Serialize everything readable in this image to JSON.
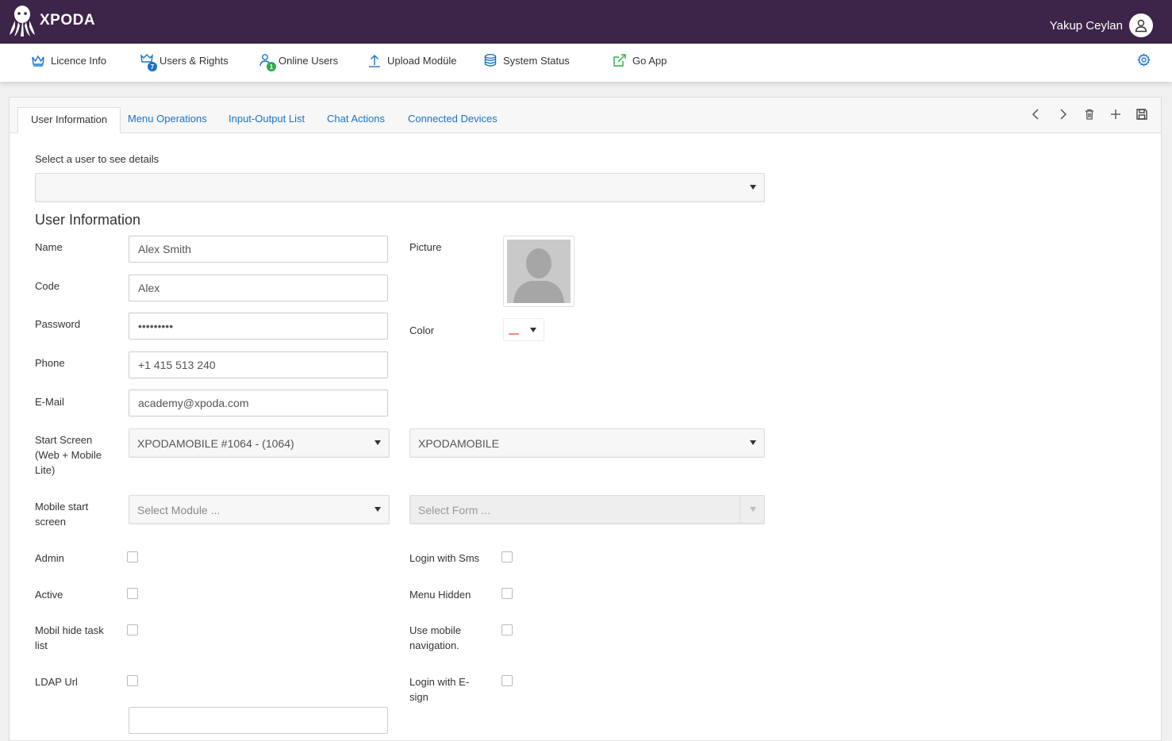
{
  "app": {
    "brand": "XPODA",
    "user_name": "Yakup Ceylan"
  },
  "nav": {
    "items": [
      {
        "label": "Licence Info",
        "icon": "crown-icon"
      },
      {
        "label": "Users & Rights",
        "icon": "users-rights-icon",
        "badge": "7"
      },
      {
        "label": "Online Users",
        "icon": "online-users-icon",
        "badge": "1"
      },
      {
        "label": "Upload Modüle",
        "icon": "upload-icon"
      },
      {
        "label": "System Status",
        "icon": "database-icon"
      },
      {
        "label": "Go App",
        "icon": "external-link-icon"
      }
    ],
    "settings_icon": "gear-icon"
  },
  "tabs": [
    {
      "label": "User Information",
      "active": true
    },
    {
      "label": "Menu Operations"
    },
    {
      "label": "Input-Output List"
    },
    {
      "label": "Chat Actions"
    },
    {
      "label": "Connected Devices"
    }
  ],
  "toolbar": [
    "chevron-left-icon",
    "chevron-right-icon",
    "trash-icon",
    "plus-icon",
    "save-icon"
  ],
  "form": {
    "select_user_label": "Select a user to see details",
    "section_title": "User Information",
    "name_label": "Name",
    "name_value": "Alex Smith",
    "code_label": "Code",
    "code_value": "Alex",
    "password_label": "Password",
    "password_value": "•••••••••",
    "phone_label": "Phone",
    "phone_value": "+1 415 513 240",
    "email_label": "E-Mail",
    "email_value": "academy@xpoda.com",
    "picture_label": "Picture",
    "color_label": "Color",
    "color_value": "#f08a80",
    "start_screen_label_1": "Start Screen",
    "start_screen_label_2": "(Web + Mobile",
    "start_screen_label_3": "Lite)",
    "start_screen_value": "XPODAMOBILE #1064 - (1064)",
    "start_screen_app": "XPODAMOBILE",
    "mobile_start_label_1": "Mobile start",
    "mobile_start_label_2": "screen",
    "mobile_module_placeholder": "Select Module ...",
    "mobile_form_placeholder": "Select Form ...",
    "admin_label": "Admin",
    "active_label": "Active",
    "mobil_hide_label_1": "Mobil hide task",
    "mobil_hide_label_2": "list",
    "ldap_label": "LDAP Url",
    "login_sms_label": "Login with Sms",
    "menu_hidden_label": "Menu Hidden",
    "use_mobile_nav_label_1": "Use mobile",
    "use_mobile_nav_label_2": "navigation.",
    "login_esign_label_1": "Login with E-",
    "login_esign_label_2": "sign"
  }
}
